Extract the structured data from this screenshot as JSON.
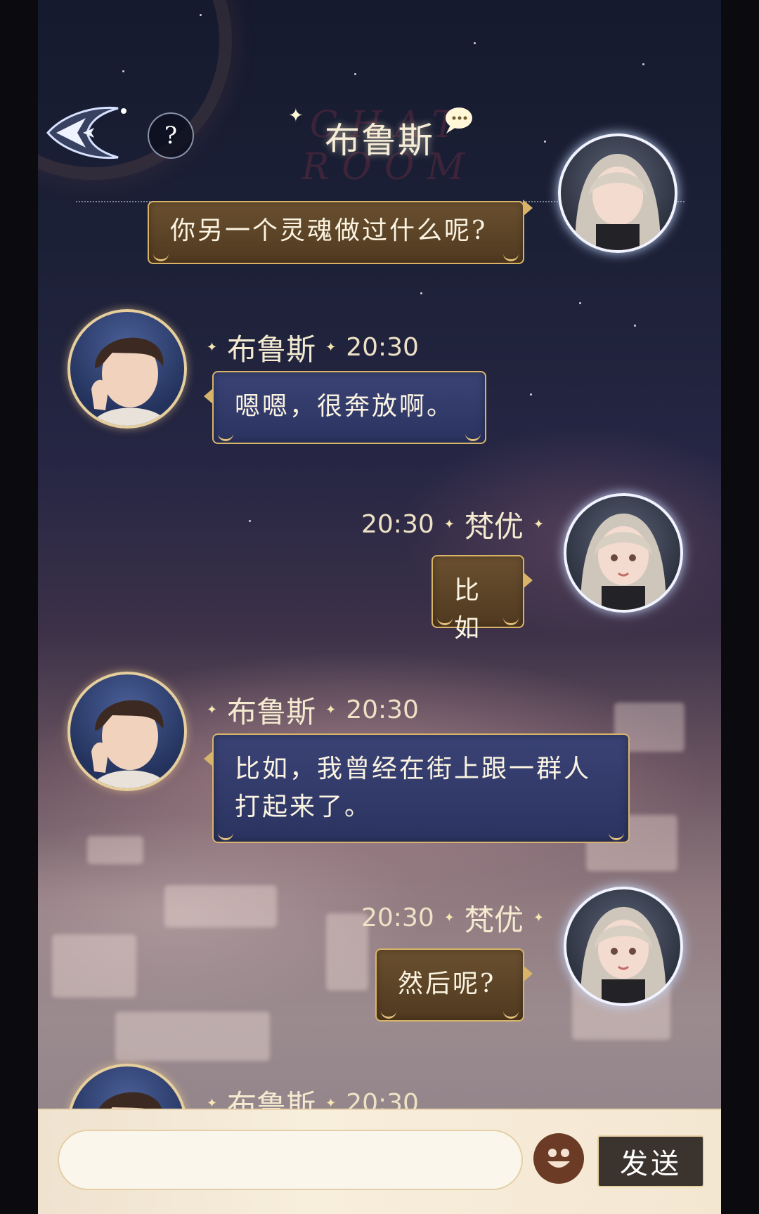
{
  "header": {
    "title": "布鲁斯",
    "watermark": "CHAT ROOM",
    "help_label": "?",
    "back_icon": "back-arrow-icon",
    "bubble_icon": "speech-bubble-icon"
  },
  "messages": [
    {
      "side": "right",
      "sender": "",
      "time": "",
      "text": "你另一个灵魂做过什么呢?"
    },
    {
      "side": "left",
      "sender": "布鲁斯",
      "time": "20:30",
      "text": "嗯嗯，很奔放啊。"
    },
    {
      "side": "right",
      "sender": "梵优",
      "time": "20:30",
      "text": "比如"
    },
    {
      "side": "left",
      "sender": "布鲁斯",
      "time": "20:30",
      "text_line1": "比如，我曾经在街上跟一群人",
      "text_line2": "打起来了。"
    },
    {
      "side": "right",
      "sender": "梵优",
      "time": "20:30",
      "text": "然后呢?"
    },
    {
      "side": "left",
      "sender": "布鲁斯",
      "time": "20:30",
      "text": ""
    }
  ],
  "input": {
    "placeholder": "",
    "send_label": "发送",
    "emoji_icon": "smiley-face-icon"
  },
  "colors": {
    "accent_gold": "#d6b46b",
    "bubble_blue": "#2f3766",
    "bubble_gold": "#5a4226",
    "send_bg": "#3a332e"
  }
}
